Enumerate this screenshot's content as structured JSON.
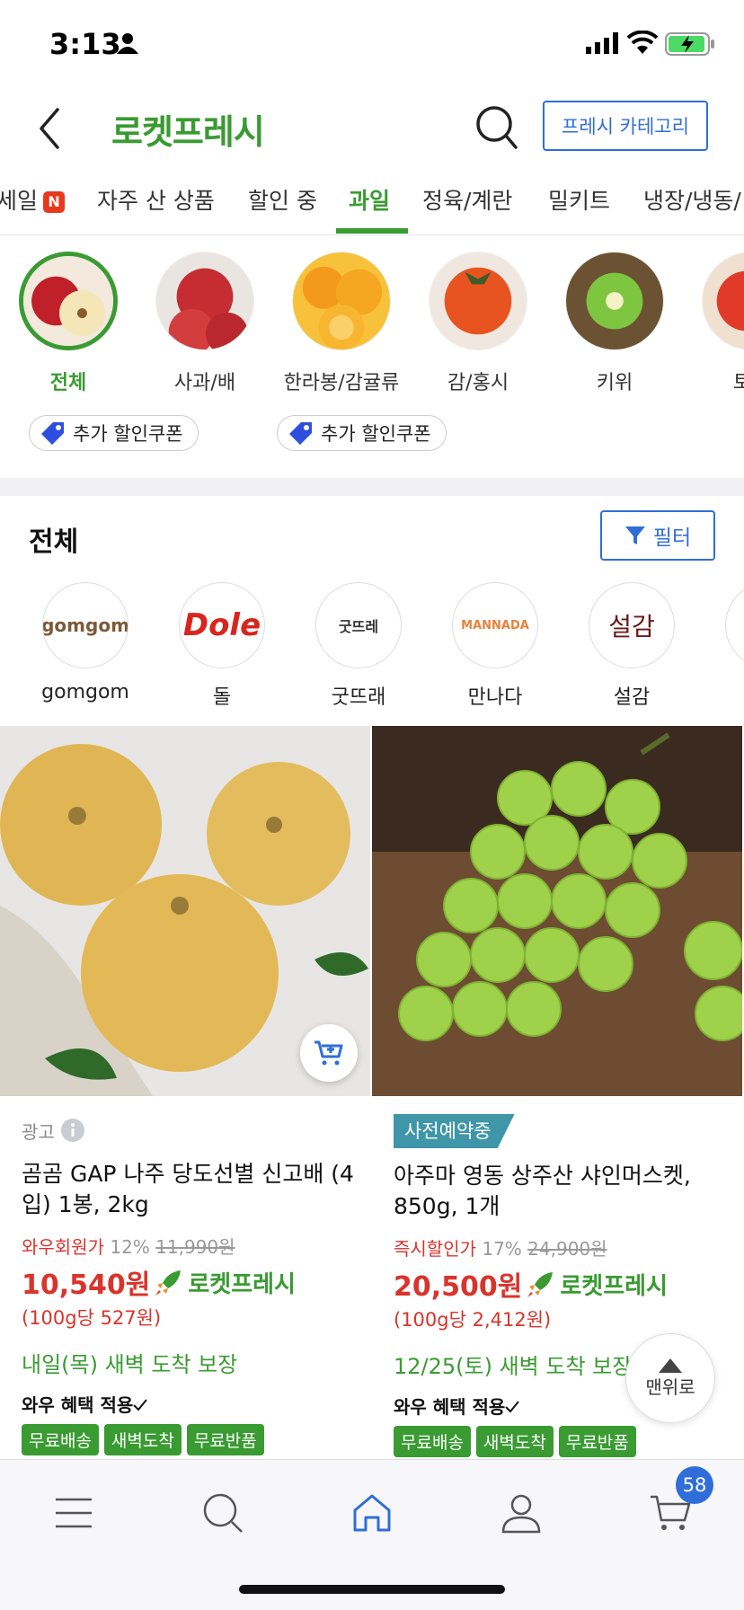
{
  "status_bar": {
    "time": "3:13"
  },
  "header": {
    "title": "로켓프레시",
    "category_button": "프레시 카테고리"
  },
  "tabs": [
    {
      "label": "세일",
      "badge": "N"
    },
    {
      "label": "자주 산 상품"
    },
    {
      "label": "할인 중"
    },
    {
      "label": "과일",
      "active": true
    },
    {
      "label": "정육/계란"
    },
    {
      "label": "밀키트"
    },
    {
      "label": "냉장/냉동/"
    }
  ],
  "categories": [
    {
      "label": "전체",
      "active": true
    },
    {
      "label": "사과/배"
    },
    {
      "label": "한라봉/감귤류"
    },
    {
      "label": "감/홍시"
    },
    {
      "label": "키위"
    },
    {
      "label": "토마"
    }
  ],
  "coupons": [
    "추가 할인쿠폰",
    "추가 할인쿠폰"
  ],
  "section": {
    "title": "전체",
    "filter_label": "필터"
  },
  "brands": [
    {
      "name": "gomgom",
      "logo_text": "gomgom"
    },
    {
      "name": "돌",
      "logo_text": "Dole"
    },
    {
      "name": "굿뜨래",
      "logo_text": "굿뜨레"
    },
    {
      "name": "만나다",
      "logo_text": "MANNADA"
    },
    {
      "name": "설감",
      "logo_text": "설감"
    }
  ],
  "products": [
    {
      "ad_label": "광고",
      "name": "곰곰 GAP 나주 당도선별 신고배 (4입) 1봉, 2kg",
      "price_kind": "와우회원가",
      "discount": "12%",
      "original_price": "11,990원",
      "price": "10,540원",
      "rocket_label": "로켓프레시",
      "unit_price": "(100g당 527원)",
      "delivery": "내일(목) 새벽 도착 보장",
      "benefit": "와우 혜택 적용",
      "chips": [
        "무료배송",
        "새벽도착",
        "무료반품"
      ]
    },
    {
      "preorder_label": "사전예약중",
      "name": "아주마 영동 상주산 샤인머스켓, 850g, 1개",
      "price_kind": "즉시할인가",
      "discount": "17%",
      "original_price": "24,900원",
      "price": "20,500원",
      "rocket_label": "로켓프레시",
      "unit_price": "(100g당 2,412원)",
      "delivery": "12/25(토) 새벽 도착 보장",
      "benefit": "와우 혜택 적용",
      "chips": [
        "무료배송",
        "새벽도착",
        "무료반품"
      ]
    }
  ],
  "top_button": "맨위로",
  "cart_count": "58",
  "colors": {
    "rocket_green": "#3a9b32",
    "price_red": "#d9342b",
    "link_blue": "#2f6ed9"
  }
}
